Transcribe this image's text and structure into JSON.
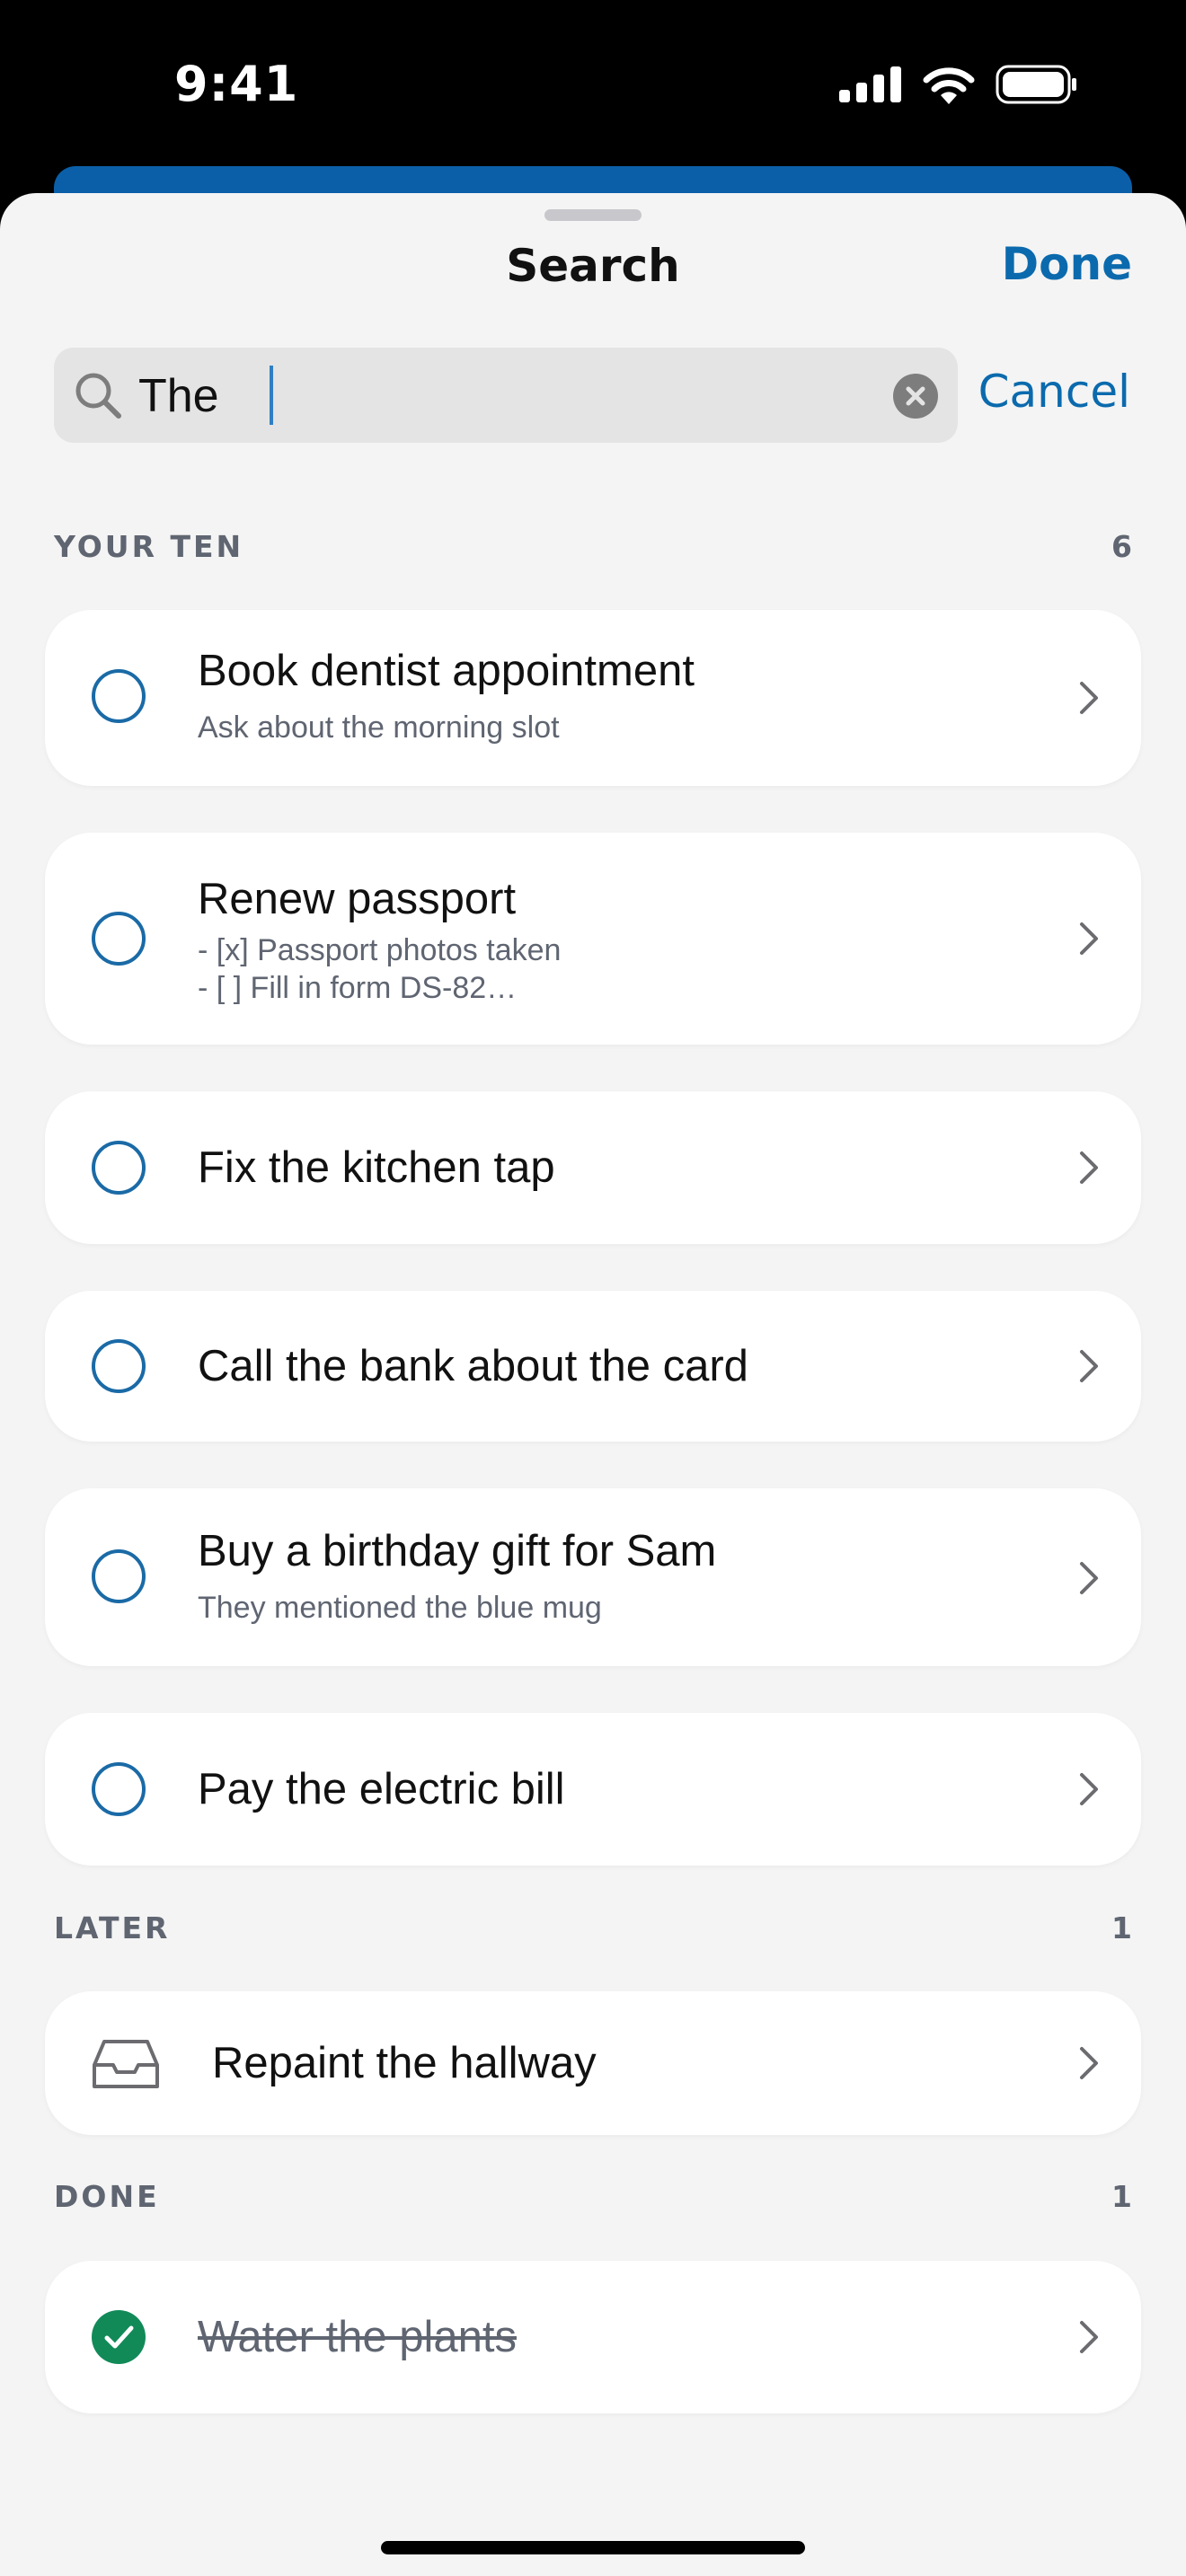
{
  "status_bar": {
    "time": "9:41"
  },
  "sheet": {
    "title": "Search",
    "done_label": "Done"
  },
  "search": {
    "query": "The",
    "cancel_label": "Cancel"
  },
  "sections": {
    "your_ten": {
      "label": "YOUR TEN",
      "count": "6",
      "items": [
        {
          "title": "Book dentist appointment",
          "subtitle": "Ask about the morning slot"
        },
        {
          "title": "Renew passport",
          "subtitle_line1": "- [x] Passport photos taken",
          "subtitle_line2": "- [ ] Fill in form DS-82…"
        },
        {
          "title": "Fix the kitchen tap"
        },
        {
          "title": "Call the bank about the card"
        },
        {
          "title": "Buy a birthday gift for Sam",
          "subtitle": "They mentioned the blue mug"
        },
        {
          "title": "Pay the electric bill"
        }
      ]
    },
    "later": {
      "label": "LATER",
      "count": "1",
      "items": [
        {
          "title": "Repaint the hallway",
          "icon": "inbox-tray-icon"
        }
      ]
    },
    "done": {
      "label": "DONE",
      "count": "1",
      "items": [
        {
          "title": "Water the plants",
          "completed": true
        }
      ]
    }
  },
  "colors": {
    "accent": "#0b6aad",
    "done_green": "#118a58",
    "sheet_bg": "#f4f4f4"
  }
}
